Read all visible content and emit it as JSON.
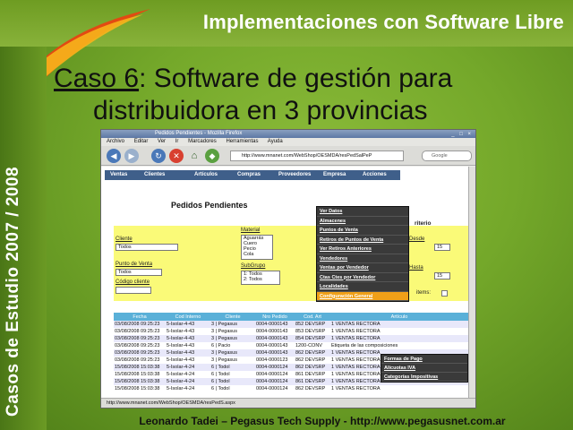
{
  "slide": {
    "header_title": "Implementaciones con Software Libre",
    "side_text": "Casos de Estudio 2007 / 2008",
    "title_caso": "Caso 6",
    "title_rest_line1": ":  Software de gestión para",
    "title_line2": "distribuidora en 3 provincias",
    "footer": "Leonardo Tadei – Pegasus Tech Supply - http://www.pegasusnet.com.ar"
  },
  "browser": {
    "window_title": "Pedidos Pendientes - Mozilla Firefox",
    "window_buttons": "_ □ ×",
    "menu": [
      "Archivo",
      "Editar",
      "Ver",
      "Ir",
      "Marcadores",
      "Herramientas",
      "Ayuda"
    ],
    "url": "http://www.mnanet.com/WebShop/OESMDA/resPedSalPeP",
    "search_placeholder": "Google",
    "status": "http://www.mnanet.com/WebShop/OESMDA/resPedS.aspx",
    "colors": {
      "nav_bg": "#3f5f8a",
      "highlight": "#f0a018",
      "form_bg": "#fafa78",
      "grid_header": "#5ab0d8"
    }
  },
  "app": {
    "nav": [
      "Ventas",
      "Clientes",
      "Artículos",
      "Compras",
      "Proveedores",
      "Empresa",
      "Acciones"
    ],
    "page_heading": "Pedidos Pendientes",
    "dropdown": [
      "Ver Datos",
      "Almacenes",
      "Puntos de Venta",
      "Retiros de Puntos de Venta",
      "Ver Retiros Anteriores",
      "Vendedores",
      "Ventas por Vendedor",
      "Ctas Ctes por Vendedor",
      "Localidades",
      "Configuración General"
    ],
    "submenu": [
      "Formas de Pago",
      "Alícuotas IVA",
      "Categorías Impositivas"
    ],
    "form": {
      "cliente_label": "Cliente",
      "cliente_value": "Todos",
      "punto_venta_label": "Punto de Venta",
      "punto_venta_value": "Todos",
      "codigo_label": "Código cliente",
      "material_label": "Material",
      "material_options": [
        "Aguarrás",
        "Cuero",
        "Pecio",
        "Cola"
      ],
      "subgrupo_label": "SubGrupo",
      "subgrupo_options": [
        "1: Todos",
        "2: Todos"
      ],
      "fecha_desde_label": "Desde",
      "fecha_hasta_label": "Hasta",
      "dia_value": "15",
      "criterio": "riterio",
      "items_label": "items:"
    },
    "grid": {
      "headers": [
        "Fecha",
        "Cod Interno",
        "Cliente",
        "Nro Pedido",
        "Cod. Art",
        "Artículo"
      ],
      "rows": [
        [
          "03/08/2008 09:25:23",
          "5-Isolar-4-43",
          "3 | Pegasus",
          "0004-0000143",
          "852 DEVSRP",
          "1 VENTAS RECTORA"
        ],
        [
          "03/08/2008 09:25:23",
          "5-Isolar-4-43",
          "3 | Pegasus",
          "0004-0000143",
          "853 DEVSRP",
          "1 VENTAS RECTORA"
        ],
        [
          "03/08/2008 09:25:23",
          "5-Isolar-4-43",
          "3 | Pegasus",
          "0004-0000143",
          "854 DEVSRP",
          "1 VENTAS RECTORA"
        ],
        [
          "03/08/2008 09:25:23",
          "5-Isolar-4-43",
          "6 | Pacio",
          "0004-0000143",
          "1200-CONV",
          "Etiqueta de las composiciones"
        ],
        [
          "03/08/2008 09:25:23",
          "5-Isolar-4-43",
          "3 | Pegasus",
          "0004-0000143",
          "862 DEVSRP",
          "1 VENTAS RECTORA"
        ],
        [
          "03/08/2008 09:25:23",
          "5-Isolar-4-43",
          "3 | Pegasus",
          "0004-0000123",
          "862 DEVSRP",
          "1 VENTAS RECTORA"
        ],
        [
          "15/08/2008 15:03:38",
          "5-Isolar-4-24",
          "6 | Todol",
          "0004-0000124",
          "862 DEVSRP",
          "1 VENTAS RECTORA"
        ],
        [
          "15/08/2008 15:03:38",
          "5-Isolar-4-24",
          "6 | Todol",
          "0004-0000124",
          "861 DEVSRP",
          "1 VENTAS RECTORA"
        ],
        [
          "15/08/2008 15:03:38",
          "5-Isolar-4-24",
          "6 | Todol",
          "0004-0000124",
          "861 DEVSRP",
          "1 VENTAS RECTORA"
        ],
        [
          "15/08/2008 15:03:38",
          "5-Isolar-4-24",
          "6 | Todol",
          "0004-0000124",
          "862 DEVSRP",
          "1 VENTAS RECTORA"
        ]
      ]
    }
  }
}
